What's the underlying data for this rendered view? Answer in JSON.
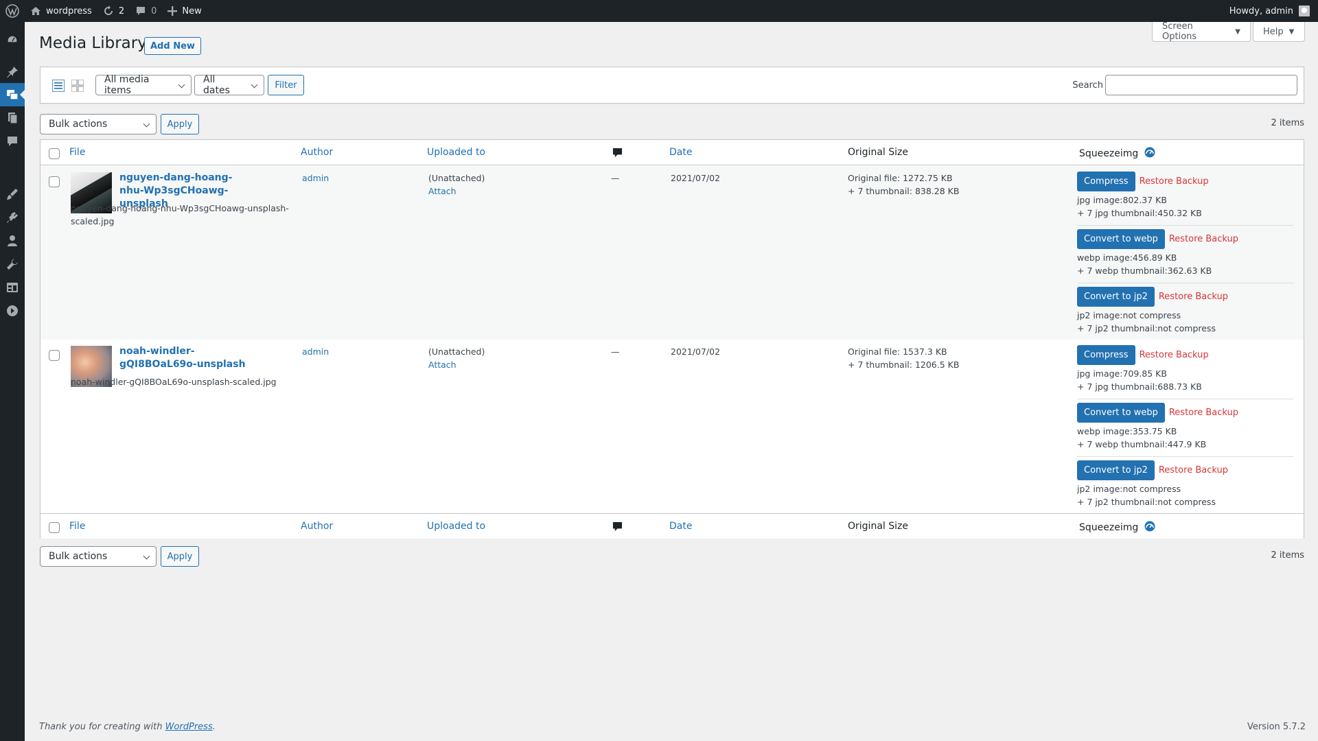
{
  "adminbar": {
    "site_name": "wordpress",
    "updates_count": "2",
    "comments_count": "0",
    "new_label": "New",
    "howdy": "Howdy, admin"
  },
  "header": {
    "title": "Media Library",
    "add_new": "Add New",
    "screen_options": "Screen Options",
    "help": "Help"
  },
  "filters": {
    "media_type": "All media items",
    "dates": "All dates",
    "filter_button": "Filter",
    "search_label": "Search",
    "search_value": ""
  },
  "bulk": {
    "label": "Bulk actions",
    "apply": "Apply",
    "items_count": "2 items"
  },
  "columns": {
    "file": "File",
    "author": "Author",
    "uploaded_to": "Uploaded to",
    "date": "Date",
    "original_size": "Original Size",
    "squeezeimg": "Squeezeimg"
  },
  "rows": [
    {
      "title": "nguyen-dang-hoang-nhu-Wp3sgCHoawg-unsplash",
      "filename": "nguyen-dang-hoang-nhu-Wp3sgCHoawg-unsplash-scaled.jpg",
      "author": "admin",
      "uploaded": "(Unattached)",
      "attach": "Attach",
      "comments": "—",
      "date": "2021/07/02",
      "orig_file": "Original file: 1272.75 KB",
      "orig_thumbs": "+ 7 thumbnail: 838.28 KB",
      "squeeze": [
        {
          "button": "Compress",
          "restore": "Restore Backup",
          "line1": "jpg image:802.37 KB",
          "line2": "+ 7 jpg thumbnail:450.32 KB"
        },
        {
          "button": "Convert to webp",
          "restore": "Restore Backup",
          "line1": "webp image:456.89 KB",
          "line2": "+ 7 webp thumbnail:362.63 KB"
        },
        {
          "button": "Convert to jp2",
          "restore": "Restore Backup",
          "line1": "jp2 image:not compress",
          "line2": "+ 7 jp2 thumbnail:not compress"
        }
      ]
    },
    {
      "title": "noah-windler-gQI8BOaL69o-unsplash",
      "filename": "noah-windler-gQI8BOaL69o-unsplash-scaled.jpg",
      "author": "admin",
      "uploaded": "(Unattached)",
      "attach": "Attach",
      "comments": "—",
      "date": "2021/07/02",
      "orig_file": "Original file: 1537.3 KB",
      "orig_thumbs": "+ 7 thumbnail: 1206.5 KB",
      "squeeze": [
        {
          "button": "Compress",
          "restore": "Restore Backup",
          "line1": "jpg image:709.85 KB",
          "line2": "+ 7 jpg thumbnail:688.73 KB"
        },
        {
          "button": "Convert to webp",
          "restore": "Restore Backup",
          "line1": "webp image:353.75 KB",
          "line2": "+ 7 webp thumbnail:447.9 KB"
        },
        {
          "button": "Convert to jp2",
          "restore": "Restore Backup",
          "line1": "jp2 image:not compress",
          "line2": "+ 7 jp2 thumbnail:not compress"
        }
      ]
    }
  ],
  "footer": {
    "thanks_prefix": "Thank you for creating with ",
    "thanks_link": "WordPress",
    "thanks_suffix": ".",
    "version": "Version 5.7.2"
  },
  "colors": {
    "adminbar_bg": "#1d2327",
    "accent": "#2271b1",
    "danger": "#d63638",
    "page_bg": "#f0f0f1"
  }
}
